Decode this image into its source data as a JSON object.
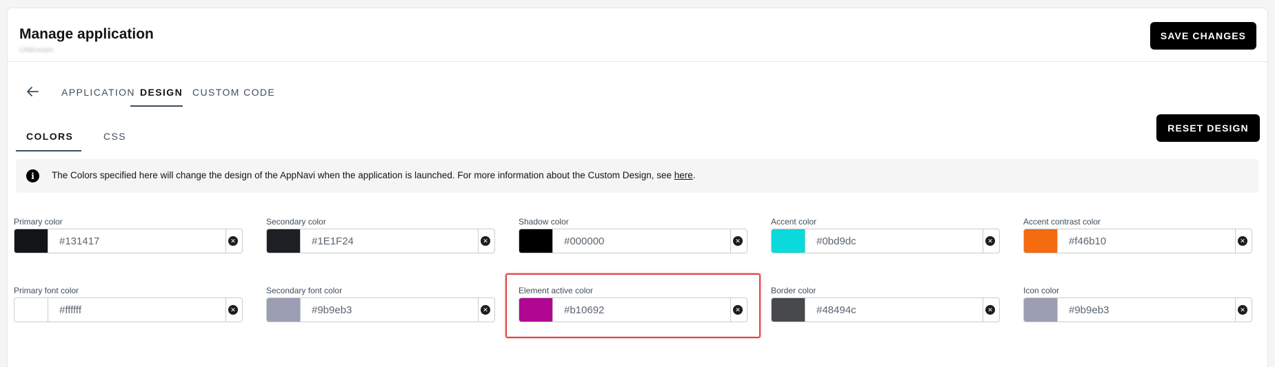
{
  "header": {
    "title": "Manage application",
    "subtitle": "UNKnown",
    "save_label": "SAVE CHANGES"
  },
  "tabs": [
    "APPLICATION",
    "DESIGN",
    "CUSTOM CODE"
  ],
  "active_tab": "DESIGN",
  "subtabs": [
    "COLORS",
    "CSS"
  ],
  "active_subtab": "COLORS",
  "reset_label": "RESET DESIGN",
  "info": {
    "text": "The Colors specified here will change the design of the AppNavi when the application is launched. For more information about the Custom Design, see ",
    "link": "here",
    "suffix": "."
  },
  "colors": [
    {
      "label": "Primary color",
      "value": "#131417",
      "swatch": "#131417"
    },
    {
      "label": "Secondary color",
      "value": "#1E1F24",
      "swatch": "#1E1F24"
    },
    {
      "label": "Shadow color",
      "value": "#000000",
      "swatch": "#000000"
    },
    {
      "label": "Accent color",
      "value": "#0bd9dc",
      "swatch": "#0bd9dc"
    },
    {
      "label": "Accent contrast color",
      "value": "#f46b10",
      "swatch": "#f46b10"
    },
    {
      "label": "Primary font color",
      "value": "#ffffff",
      "swatch": "#ffffff"
    },
    {
      "label": "Secondary font color",
      "value": "#9b9eb3",
      "swatch": "#9b9eb3"
    },
    {
      "label": "Element active color",
      "value": "#b10692",
      "swatch": "#b10692"
    },
    {
      "label": "Border color",
      "value": "#48494c",
      "swatch": "#48494c"
    },
    {
      "label": "Icon color",
      "value": "#9b9eb3",
      "swatch": "#9b9eb3"
    }
  ],
  "icons": {
    "back": "arrow-left-icon",
    "info": "info-icon",
    "clear": "clear-circle-icon"
  }
}
